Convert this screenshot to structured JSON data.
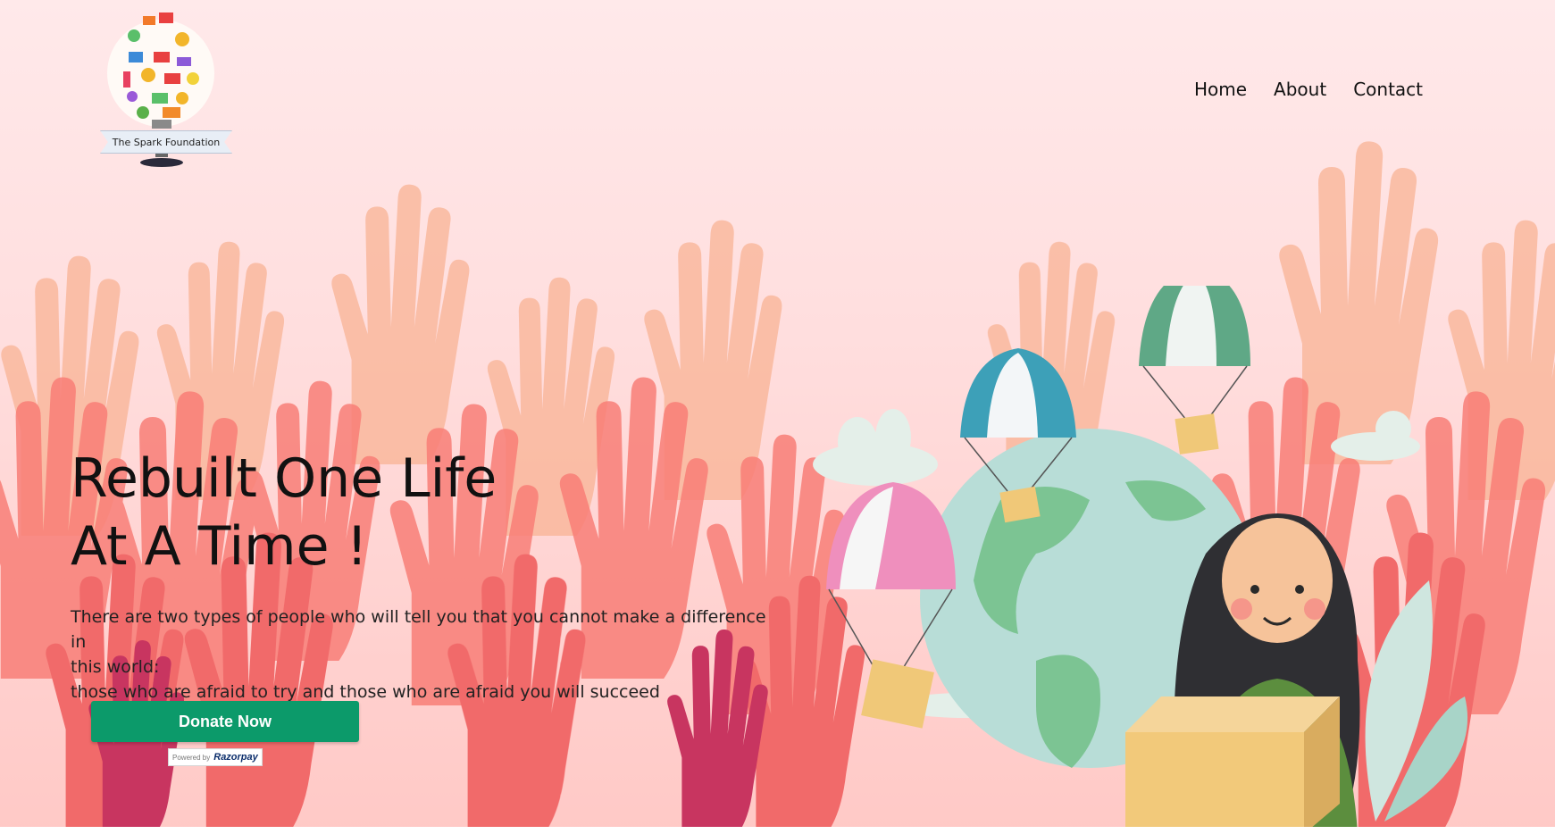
{
  "logo": {
    "alt": "The Spark Foundation"
  },
  "nav": {
    "items": [
      {
        "label": "Home"
      },
      {
        "label": "About"
      },
      {
        "label": "Contact"
      }
    ]
  },
  "hero": {
    "title_line1": "Rebuilt One Life",
    "title_line2": "At A Time !",
    "subtitle_line1": "There are two types of people who will tell you that you cannot make a difference in",
    "subtitle_line2": "this world:",
    "subtitle_line3": "those who are afraid to try and those who are afraid you will succeed",
    "donate_label": "Donate Now",
    "powered_by": "Powered by",
    "payment_brand": "Razorpay"
  },
  "colors": {
    "donate": "#0c9a6a",
    "hands_primary": "#f76e6e",
    "hands_secondary": "#f9a487",
    "hands_dark": "#c83560"
  }
}
